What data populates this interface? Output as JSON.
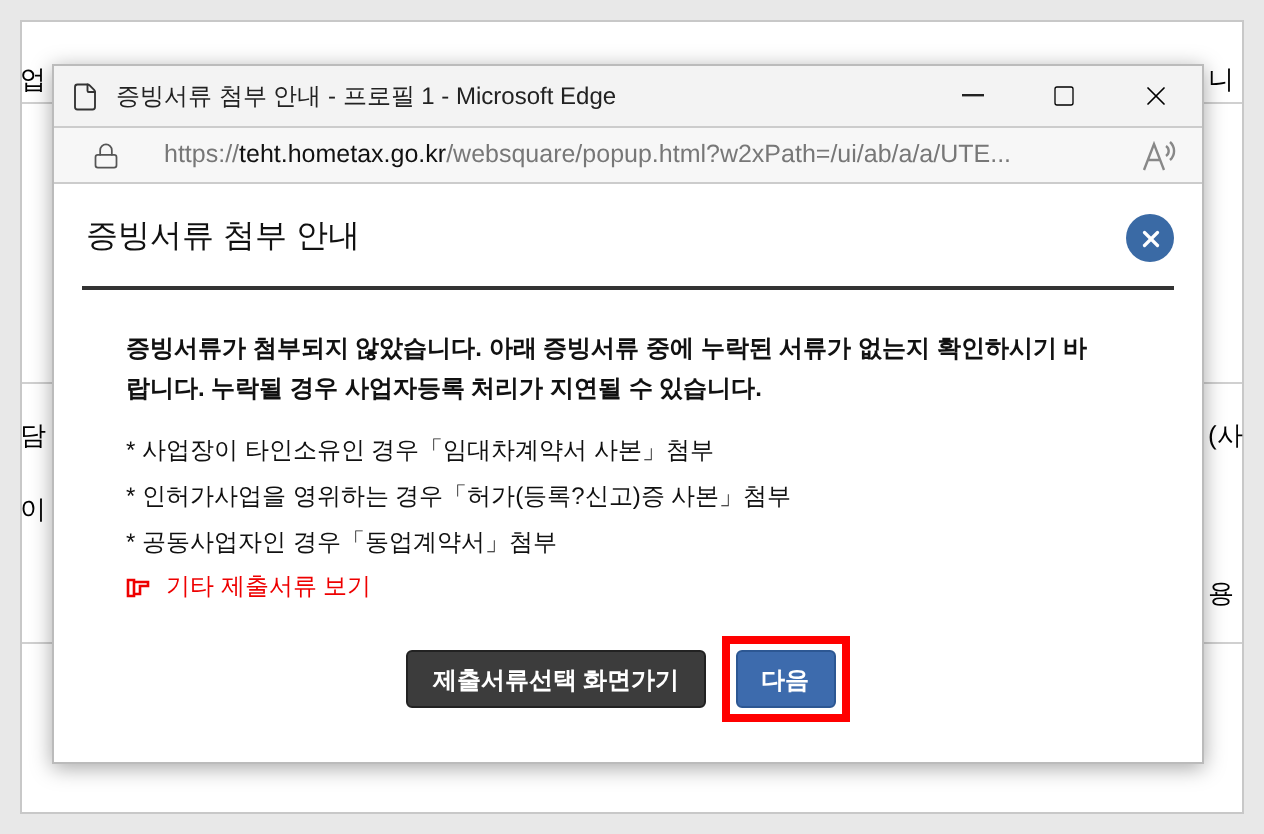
{
  "background_page": {
    "left_fragments": [
      "업",
      "담",
      "이"
    ],
    "right_fragments": [
      "니",
      "(사",
      "용"
    ]
  },
  "window": {
    "title": "증빙서류 첨부 안내 - 프로필 1 - Microsoft Edge",
    "url_scheme": "https://",
    "url_host": "teht.hometax.go.kr",
    "url_path": "/websquare/popup.html?w2xPath=/ui/ab/a/a/UTE..."
  },
  "dialog": {
    "title": "증빙서류 첨부 안내",
    "message": "증빙서류가 첨부되지 않았습니다. 아래 증빙서류 중에 누락된 서류가 없는지 확인하시기 바랍니다. 누락될 경우 사업자등록 처리가 지연될 수 있습니다.",
    "items": [
      "* 사업장이 타인소유인 경우「임대차계약서 사본」첨부",
      "* 인허가사업을 영위하는 경우「허가(등록?신고)증 사본」첨부",
      "* 공동사업자인 경우「동업계약서」첨부"
    ],
    "link": "기타 제출서류 보기",
    "buttons": [
      {
        "label": "제출서류선택 화면가기",
        "kind": "dark",
        "highlighted": false
      },
      {
        "label": "다음",
        "kind": "primary",
        "highlighted": true
      }
    ]
  }
}
